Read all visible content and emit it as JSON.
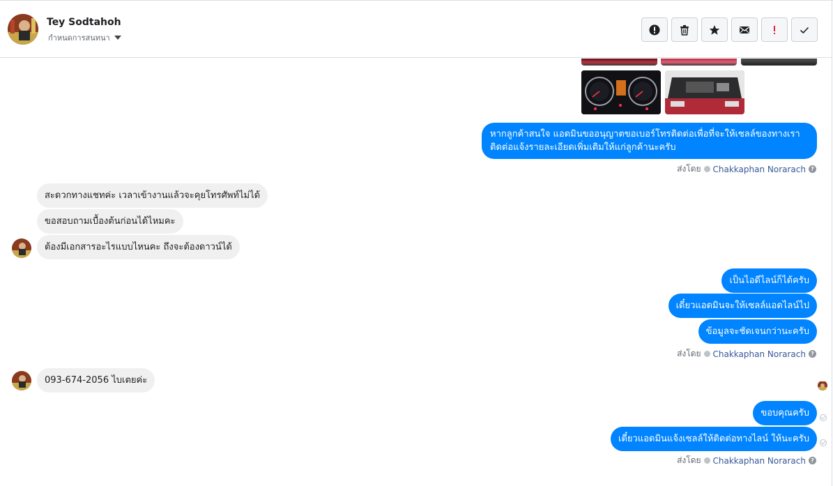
{
  "header": {
    "contact_name": "Tey Sodtahoh",
    "assign_label": "กำหนดการสนทนา",
    "toolbar": [
      {
        "icon": "info-icon",
        "label": "!"
      },
      {
        "icon": "trash-icon",
        "label": ""
      },
      {
        "icon": "star-icon",
        "label": ""
      },
      {
        "icon": "mail-icon",
        "label": ""
      },
      {
        "icon": "exclamation-icon",
        "label": "!"
      },
      {
        "icon": "check-icon",
        "label": ""
      }
    ]
  },
  "colors": {
    "outgoing": "#0084ff",
    "incoming": "#f1f0f0",
    "link": "#385898",
    "exclamation": "#e41e3f"
  },
  "messages": {
    "out1": "หากลูกค้าสนใจ แอดมินขออนุญาตขอเบอร์โทรติดต่อเพื่อที่จะให้เซลล์ของทางเรา",
    "out1_line2": "ติดต่อแจ้งรายละเอียดเพิ่มเติมให้แก่ลูกค้านะครับ",
    "in1": "สะดวกทางแชทค่ะ เวลาเข้างานแล้วจะคุยโทรศัพท์ไม่ได้",
    "in2": "ขอสอบถามเบื้องต้นก่อนได้ไหมคะ",
    "in3": "ต้องมีเอกสารอะไรแบบไหนคะ ถึงจะต้องดาวน์ได้",
    "out2": "เป็นไอดีไลน์ก็ได้ครับ",
    "out3": "เดี๋ยวแอดมินจะให้เซลล์แอดไลน์ไป",
    "out4": "ข้อมูลจะชัดเจนกว่านะครับ",
    "in4": "093-674-2056 ไบเตยค่ะ",
    "out5": "ขอบคุณครับ",
    "out6": "เดี๋ยวแอดมินแจ้งเซลล์ให้ติดต่อทางไลน์ ให้นะครับ"
  },
  "sent_by": {
    "prefix": "ส่งโดย",
    "name": "Chakkaphan Norarach",
    "help": "?"
  }
}
